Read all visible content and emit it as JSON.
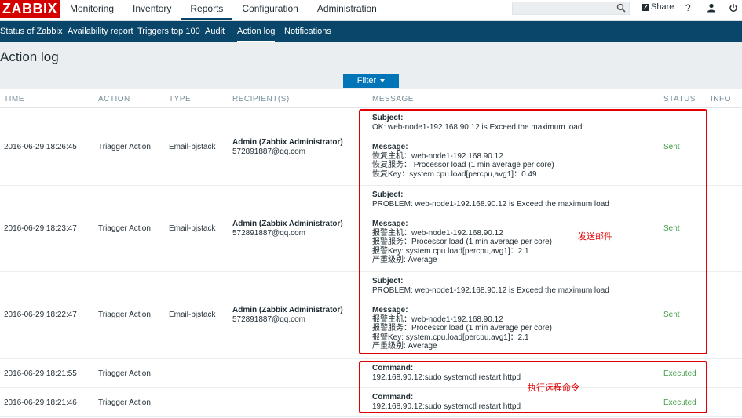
{
  "topbar": {
    "logo": "ZABBIX",
    "menu": [
      "Monitoring",
      "Inventory",
      "Reports",
      "Configuration",
      "Administration"
    ],
    "active_menu": "Reports",
    "search_placeholder": "",
    "share_label": "Share",
    "help_label": "?"
  },
  "subnav": {
    "items": [
      "Status of Zabbix",
      "Availability report",
      "Triggers top 100",
      "Audit",
      "Action log",
      "Notifications"
    ],
    "active": "Action log"
  },
  "page": {
    "title": "Action log",
    "filter_label": "Filter"
  },
  "table": {
    "columns": [
      "TIME",
      "ACTION",
      "TYPE",
      "RECIPIENT(S)",
      "MESSAGE",
      "STATUS",
      "INFO"
    ],
    "rows": [
      {
        "time": "2016-06-29 18:26:45",
        "action": "Triagger Action",
        "type": "Email-bjstack",
        "recipient_name": "Admin (Zabbix Administrator)",
        "recipient_email": "572891887@qq.com",
        "subject_label": "Subject:",
        "subject": "OK: web-node1-192.168.90.12 is Exceed the maximum load",
        "message_label": "Message:",
        "message_lines": [
          "恢复主机：web-node1-192.168.90.12",
          "恢复服务： Processor load (1 min average per core)",
          "恢复Key：system.cpu.load[percpu,avg1]：0.49"
        ],
        "status": "Sent"
      },
      {
        "time": "2016-06-29 18:23:47",
        "action": "Triagger Action",
        "type": "Email-bjstack",
        "recipient_name": "Admin (Zabbix Administrator)",
        "recipient_email": "572891887@qq.com",
        "subject_label": "Subject:",
        "subject": "PROBLEM: web-node1-192.168.90.12 is Exceed the maximum load",
        "message_label": "Message:",
        "message_lines": [
          "报警主机：web-node1-192.168.90.12",
          "报警服务：Processor load (1 min average per core)",
          "报警Key: system.cpu.load[percpu,avg1]：2.1",
          "严重级别: Average"
        ],
        "status": "Sent"
      },
      {
        "time": "2016-06-29 18:22:47",
        "action": "Triagger Action",
        "type": "Email-bjstack",
        "recipient_name": "Admin (Zabbix Administrator)",
        "recipient_email": "572891887@qq.com",
        "subject_label": "Subject:",
        "subject": "PROBLEM: web-node1-192.168.90.12 is Exceed the maximum load",
        "message_label": "Message:",
        "message_lines": [
          "报警主机：web-node1-192.168.90.12",
          "报警服务：Processor load (1 min average per core)",
          "报警Key: system.cpu.load[percpu,avg1]：2.1",
          "严重级别: Average"
        ],
        "status": "Sent"
      },
      {
        "time": "2016-06-29 18:21:55",
        "action": "Triagger Action",
        "command_label": "Command:",
        "command": "192.168.90.12:sudo systemctl restart httpd",
        "status": "Executed"
      },
      {
        "time": "2016-06-29 18:21:46",
        "action": "Triagger Action",
        "command_label": "Command:",
        "command": "192.168.90.12:sudo systemctl restart httpd",
        "status": "Executed"
      }
    ]
  },
  "annotations": {
    "email_note": "发送邮件",
    "command_note": "执行远程命令"
  },
  "colors": {
    "brand_red": "#d40000",
    "nav_blue": "#0a466a",
    "filter_blue": "#0275b8",
    "status_green": "#429e47",
    "annotation_red": "#e00000"
  }
}
